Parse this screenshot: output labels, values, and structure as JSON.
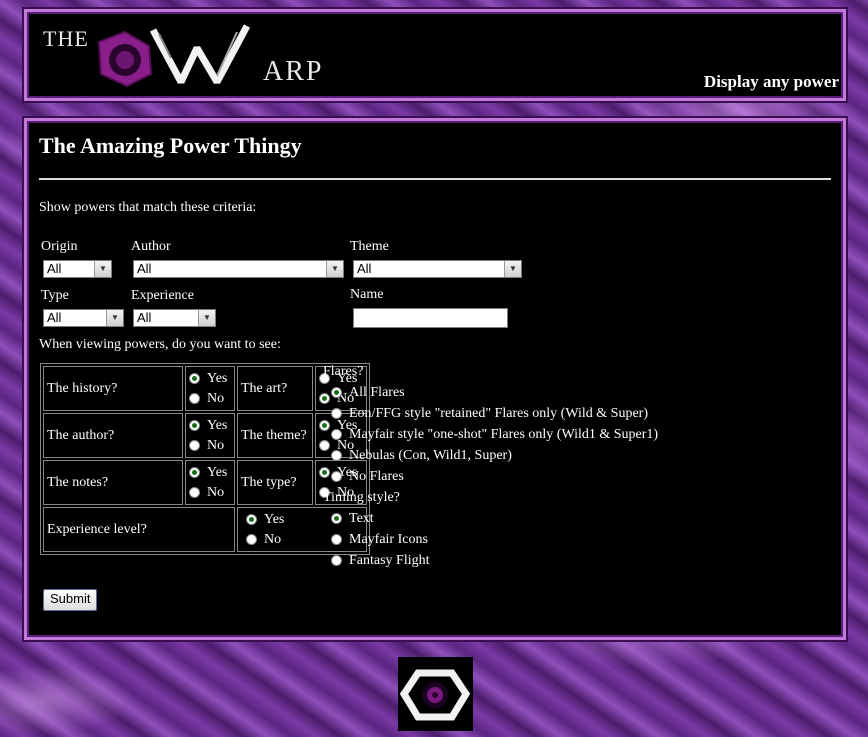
{
  "header": {
    "logo_the": "THE",
    "logo_arp": "ARP",
    "tagline": "Display any power"
  },
  "main": {
    "title": "The Amazing Power Thingy",
    "intro": "Show powers that match these criteria:",
    "filters": {
      "origin": {
        "label": "Origin",
        "value": "All"
      },
      "author": {
        "label": "Author",
        "value": "All"
      },
      "theme": {
        "label": "Theme",
        "value": "All"
      },
      "type": {
        "label": "Type",
        "value": "All"
      },
      "experience": {
        "label": "Experience",
        "value": "All"
      },
      "name": {
        "label": "Name",
        "value": ""
      }
    },
    "view_question": "When viewing powers, do you want to see:",
    "yes": "Yes",
    "no": "No",
    "view_options": [
      {
        "label": "The history?",
        "selected": "Yes"
      },
      {
        "label": "The art?",
        "selected": "No"
      },
      {
        "label": "The author?",
        "selected": "Yes"
      },
      {
        "label": "The theme?",
        "selected": "Yes"
      },
      {
        "label": "The notes?",
        "selected": "Yes"
      },
      {
        "label": "The type?",
        "selected": "Yes"
      },
      {
        "label": "Experience level?",
        "selected": "Yes"
      }
    ],
    "flares": {
      "heading": "Flares?",
      "options": [
        "All Flares",
        "Eon/FFG style \"retained\" Flares only (Wild & Super)",
        "Mayfair style \"one-shot\" Flares only (Wild1 & Super1)",
        "Nebulas (Con, Wild1, Super)",
        "No Flares"
      ],
      "selected": "All Flares"
    },
    "timing": {
      "heading": "Timing style?",
      "options": [
        "Text",
        "Mayfair Icons",
        "Fantasy Flight"
      ],
      "selected": "Text"
    },
    "submit_label": "Submit"
  },
  "colors": {
    "panel_border": "#c27ad9",
    "background_purple": "#7b3aa6",
    "radio_selected": "#1a6e1a"
  },
  "icons": {
    "logo": "warp-hexagon-logo",
    "footer": "warp-hexagon-icon"
  }
}
